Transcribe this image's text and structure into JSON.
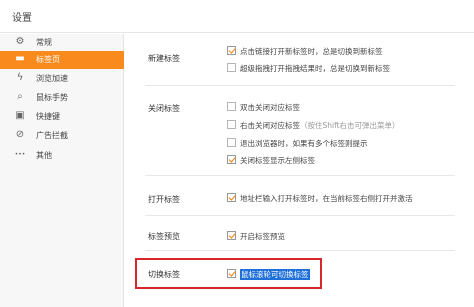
{
  "window": {
    "title": "设置"
  },
  "sidebar": {
    "items": [
      {
        "icon": "gear-icon",
        "glyph": "⚙",
        "label": "常规",
        "active": false
      },
      {
        "icon": "tab-icon",
        "glyph": "▬",
        "label": "标签页",
        "active": true
      },
      {
        "icon": "lightning-icon",
        "glyph": "ϟ",
        "label": "浏览加速",
        "active": false
      },
      {
        "icon": "mouse-gesture-icon",
        "glyph": "⌕",
        "label": "鼠标手势",
        "active": false
      },
      {
        "icon": "keyboard-icon",
        "glyph": "▣",
        "label": "快捷键",
        "active": false
      },
      {
        "icon": "block-icon",
        "glyph": "⊘",
        "label": "广告拦截",
        "active": false
      },
      {
        "icon": "more-icon",
        "glyph": "•••",
        "label": "其他",
        "active": false
      }
    ]
  },
  "sections": {
    "new_tab": {
      "label": "新建标签",
      "options": [
        {
          "text": "点击链接打开新标签时，总是切换到新标签",
          "checked": true
        },
        {
          "text": "超级拖拽打开拖拽结果时，总是切换到新标签",
          "checked": false
        }
      ]
    },
    "close_tab": {
      "label": "关闭标签",
      "options": [
        {
          "text": "双击关闭对应标签",
          "hint": "",
          "checked": false
        },
        {
          "text": "右击关闭对应标签",
          "hint": "（按住Shift右击可弹出菜单）",
          "checked": false
        },
        {
          "text": "退出浏览器时，如果有多个标签则提示",
          "hint": "",
          "checked": false
        },
        {
          "text": "关闭标签显示左侧标签",
          "hint": "",
          "checked": true
        }
      ]
    },
    "open_tab": {
      "label": "打开标签",
      "options": [
        {
          "text": "地址栏输入打开标签时，在当前标签右侧打开并激活",
          "checked": true
        }
      ]
    },
    "preview_tab": {
      "label": "标签预览",
      "options": [
        {
          "text": "开启标签预览",
          "checked": true
        }
      ]
    },
    "switch_tab": {
      "label": "切换标签",
      "options": [
        {
          "text": "鼠标滚轮可切换标签",
          "checked": true
        }
      ]
    }
  },
  "colors": {
    "accent": "#f98b1e",
    "highlight_border": "#d7262c",
    "selection": "#1e6fd9"
  }
}
